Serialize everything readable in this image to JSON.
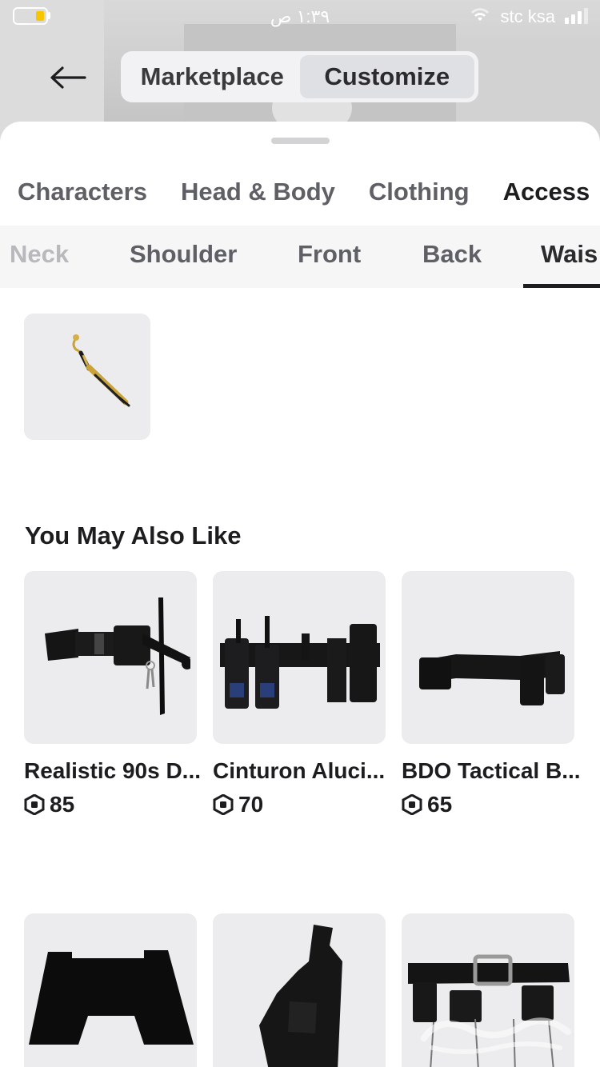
{
  "status_bar": {
    "time": "١:٣٩ ص",
    "carrier": "stc ksa"
  },
  "header": {
    "segments": [
      {
        "label": "Marketplace",
        "active": false
      },
      {
        "label": "Customize",
        "active": true
      }
    ]
  },
  "category_tabs": [
    {
      "label": "Characters",
      "active": false
    },
    {
      "label": "Head & Body",
      "active": false
    },
    {
      "label": "Clothing",
      "active": false
    },
    {
      "label": "Access",
      "active": true
    }
  ],
  "sub_tabs": [
    {
      "label": "Neck",
      "active": false
    },
    {
      "label": "Shoulder",
      "active": false
    },
    {
      "label": "Front",
      "active": false
    },
    {
      "label": "Back",
      "active": false
    },
    {
      "label": "Wais",
      "active": true
    }
  ],
  "equipped": [
    {
      "icon": "sword-icon"
    }
  ],
  "recommendations": {
    "title": "You May Also Like",
    "items": [
      {
        "name": "Realistic 90s D...",
        "price": "85",
        "icon": "duty-belt-icon"
      },
      {
        "name": "Cinturon Aluci...",
        "price": "70",
        "icon": "radio-belt-icon"
      },
      {
        "name": "BDO Tactical B...",
        "price": "65",
        "icon": "tactical-belt-icon"
      },
      {
        "name": "",
        "price": "",
        "icon": "black-skirt-icon"
      },
      {
        "name": "",
        "price": "",
        "icon": "holster-icon"
      },
      {
        "name": "",
        "price": "",
        "icon": "buckle-belt-icon"
      }
    ]
  },
  "colors": {
    "sheet": "#ffffff",
    "thumb_bg": "#ececef",
    "active_segment": "#dfe0e4",
    "text_primary": "#1d1d1f",
    "text_secondary": "#5f6066"
  }
}
